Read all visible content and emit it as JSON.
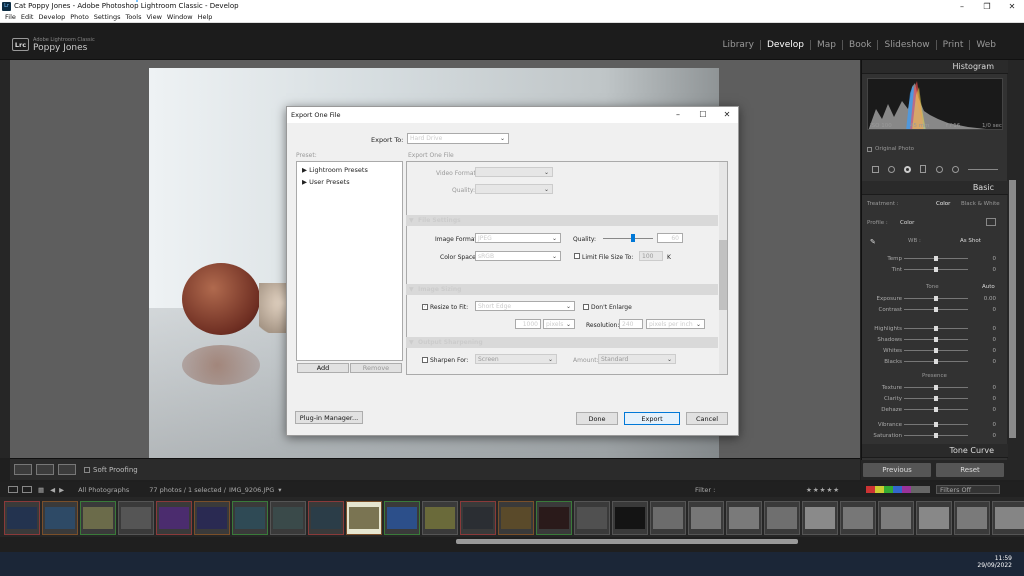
{
  "window": {
    "title": "Cat Poppy Jones - Adobe Photoshop Lightroom Classic - Develop"
  },
  "menu": [
    "File",
    "Edit",
    "Develop",
    "Photo",
    "Settings",
    "Tools",
    "View",
    "Window",
    "Help"
  ],
  "identity": {
    "app_subtitle": "Adobe Lightroom Classic",
    "user": "Poppy Jones",
    "logo": "Lrc"
  },
  "modules": [
    {
      "label": "Library",
      "active": false
    },
    {
      "label": "Develop",
      "active": true
    },
    {
      "label": "Map",
      "active": false
    },
    {
      "label": "Book",
      "active": false
    },
    {
      "label": "Slideshow",
      "active": false
    },
    {
      "label": "Print",
      "active": false
    },
    {
      "label": "Web",
      "active": false
    }
  ],
  "toolbar": {
    "soft_proofing": "Soft Proofing"
  },
  "right_panel": {
    "histogram_title": "Histogram",
    "histo_info": [
      "ISO 100",
      "45 mm",
      "f / 16",
      "1/0 sec"
    ],
    "original_photo": "Original Photo",
    "basic_title": "Basic",
    "treatment_label": "Treatment :",
    "treatment_color": "Color",
    "treatment_bw": "Black & White",
    "profile_label": "Profile :",
    "profile_value": "Color",
    "wb_label": "WB :",
    "wb_value": "As Shot",
    "tone_label": "Tone",
    "tone_auto": "Auto",
    "presence_label": "Presence",
    "sliders_wb": [
      {
        "label": "Temp",
        "value": "0"
      },
      {
        "label": "Tint",
        "value": "0"
      }
    ],
    "sliders_tone": [
      {
        "label": "Exposure",
        "value": "0.00"
      },
      {
        "label": "Contrast",
        "value": "0"
      },
      {
        "label": "Highlights",
        "value": "0"
      },
      {
        "label": "Shadows",
        "value": "0"
      },
      {
        "label": "Whites",
        "value": "0"
      },
      {
        "label": "Blacks",
        "value": "0"
      }
    ],
    "sliders_presence": [
      {
        "label": "Texture",
        "value": "0"
      },
      {
        "label": "Clarity",
        "value": "0"
      },
      {
        "label": "Dehaze",
        "value": "0"
      },
      {
        "label": "Vibrance",
        "value": "0"
      },
      {
        "label": "Saturation",
        "value": "0"
      }
    ],
    "tone_curve_title": "Tone Curve",
    "previous": "Previous",
    "reset": "Reset"
  },
  "filmbar": {
    "source": "All Photographs",
    "count": "77 photos / 1 selected /",
    "filename": "IMG_9206.JPG",
    "filter_label": "Filter :",
    "filters_off": "Filters Off"
  },
  "taskbar": {
    "time": "11:59",
    "date": "29/09/2022"
  },
  "dialog": {
    "title": "Export One File",
    "export_to_label": "Export To:",
    "export_to_value": "Hard Drive",
    "preset_label": "Preset:",
    "export_one_file_label": "Export One File",
    "presets": [
      "Lightroom Presets",
      "User Presets"
    ],
    "add": "Add",
    "remove": "Remove",
    "video_format_label": "Video Format:",
    "quality_label_video": "Quality:",
    "file_settings": "File Settings",
    "image_format_label": "Image Format:",
    "image_format_value": "JPEG",
    "quality_label": "Quality:",
    "quality_value": "60",
    "color_space_label": "Color Space:",
    "color_space_value": "sRGB",
    "limit_file_size": "Limit File Size To:",
    "limit_value": "100",
    "limit_unit": "K",
    "image_sizing": "Image Sizing",
    "resize_to_fit": "Resize to Fit:",
    "resize_value": "Short Edge",
    "dont_enlarge": "Don't Enlarge",
    "size_value": "1000",
    "size_unit": "pixels",
    "resolution_label": "Resolution:",
    "resolution_value": "240",
    "resolution_unit": "pixels per inch",
    "output_sharpening": "Output Sharpening",
    "sharpen_for": "Sharpen For:",
    "sharpen_value": "Screen",
    "amount_label": "Amount:",
    "amount_value": "Standard",
    "plugin_manager": "Plug-in Manager...",
    "done": "Done",
    "export": "Export",
    "cancel": "Cancel"
  }
}
